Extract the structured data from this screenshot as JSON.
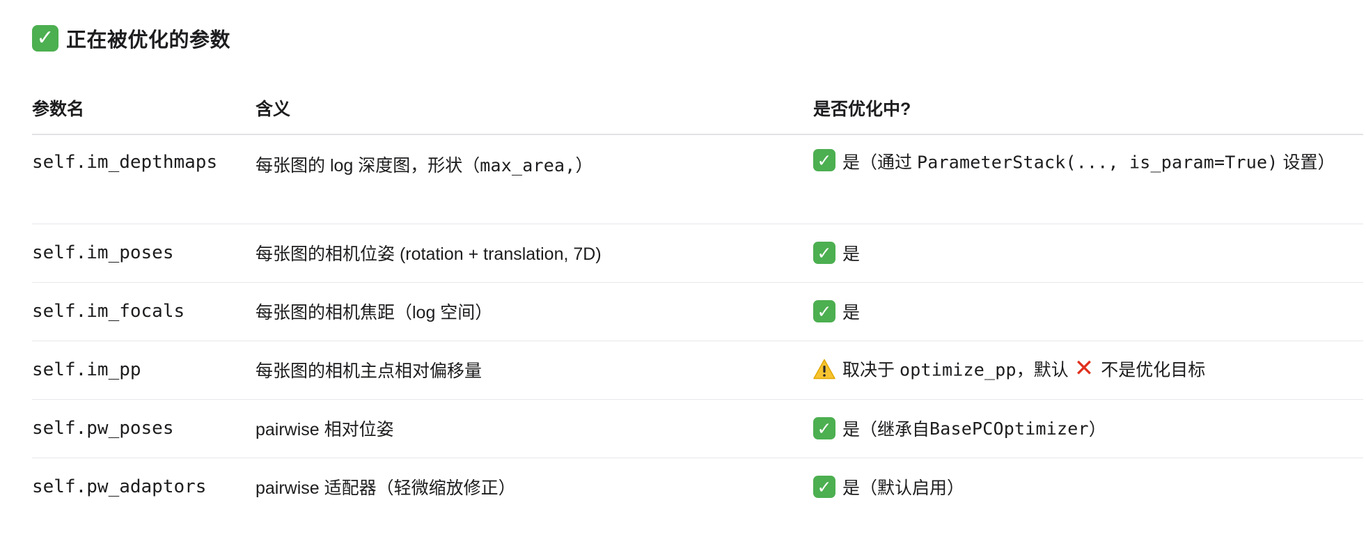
{
  "heading": {
    "icon": "check-mark-button-icon",
    "title": "正在被优化的参数"
  },
  "table": {
    "headers": [
      "参数名",
      "含义",
      "是否优化中?"
    ],
    "rows": [
      {
        "name": "self.im_depthmaps",
        "meaning_prefix": "每张图的 log 深度图，形状（",
        "meaning_code": "max_area,",
        "meaning_suffix": "）",
        "status_icon": "check-mark-button-icon",
        "status_prefix": "是（通过 ",
        "status_code": "ParameterStack(..., is_param=True)",
        "status_suffix": " 设置）"
      },
      {
        "name": "self.im_poses",
        "meaning": "每张图的相机位姿 (rotation + translation, 7D)",
        "status_icon": "check-mark-button-icon",
        "status": "是"
      },
      {
        "name": "self.im_focals",
        "meaning": "每张图的相机焦距（log 空间）",
        "status_icon": "check-mark-button-icon",
        "status": "是"
      },
      {
        "name": "self.im_pp",
        "meaning": "每张图的相机主点相对偏移量",
        "status_icon": "warning-icon",
        "status_prefix": "取决于 ",
        "status_code": "optimize_pp",
        "status_mid": "，默认",
        "status_cross_icon": "cross-mark-icon",
        "status_suffix": "不是优化目标"
      },
      {
        "name": "self.pw_poses",
        "meaning": "pairwise 相对位姿",
        "status_icon": "check-mark-button-icon",
        "status_prefix": "是（继承自 ",
        "status_code": "BasePCOptimizer",
        "status_suffix": "）"
      },
      {
        "name": "self.pw_adaptors",
        "meaning": "pairwise 适配器（轻微缩放修正）",
        "status_icon": "check-mark-button-icon",
        "status": "是（默认启用）"
      }
    ]
  },
  "colors": {
    "check_green": "#4caf50",
    "warning_yellow": "#f7c331",
    "cross_red": "#e0301e",
    "divider": "#e8e8eb"
  }
}
